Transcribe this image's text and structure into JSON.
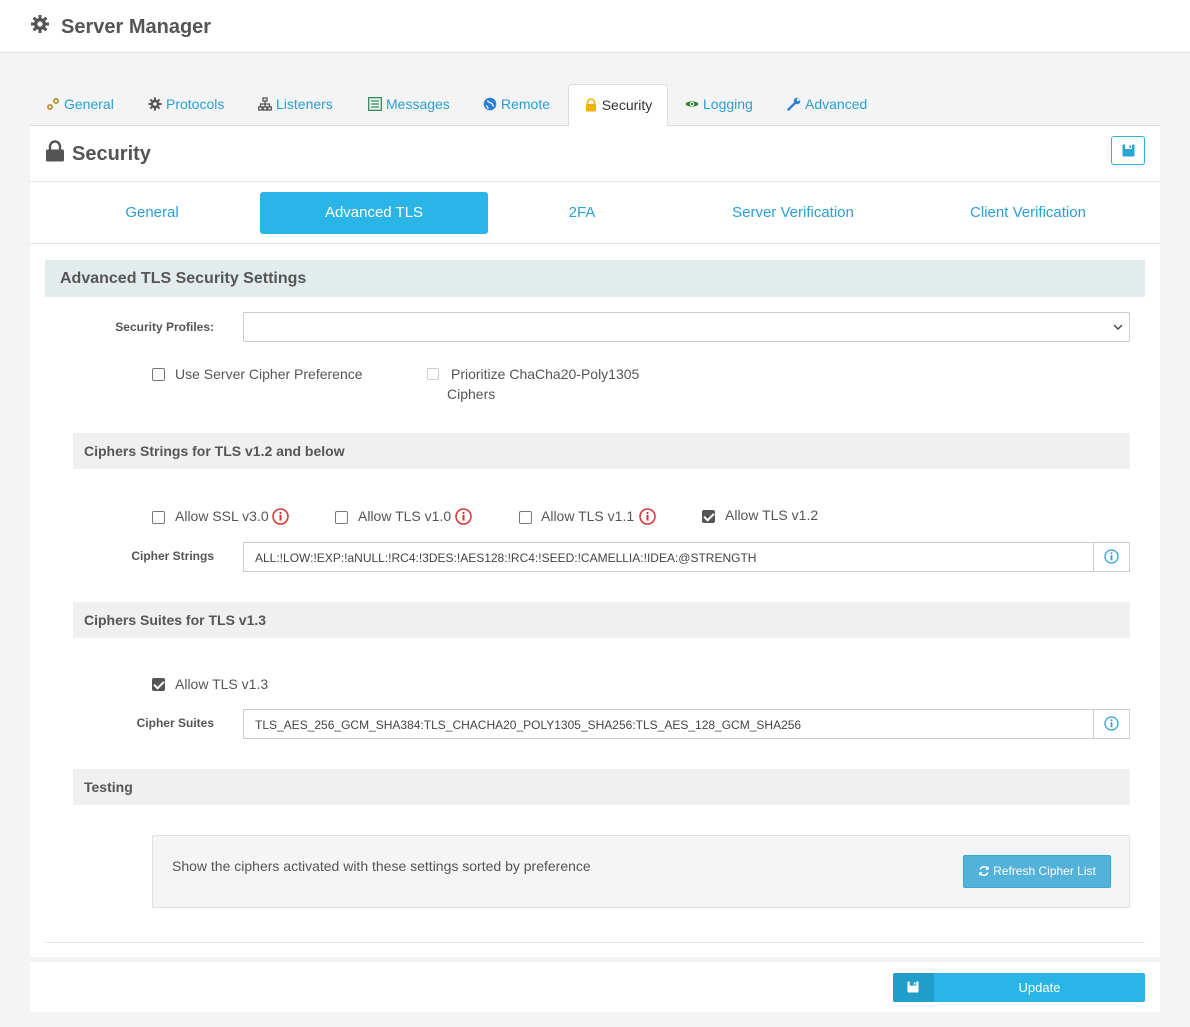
{
  "app": {
    "title": "Server Manager",
    "icon": "gear-icon"
  },
  "tabs": [
    {
      "label": "General",
      "icon": "cogs-icon"
    },
    {
      "label": "Protocols",
      "icon": "gear-icon"
    },
    {
      "label": "Listeners",
      "icon": "sitemap-icon"
    },
    {
      "label": "Messages",
      "icon": "list-icon"
    },
    {
      "label": "Remote",
      "icon": "globe-icon"
    },
    {
      "label": "Security",
      "icon": "lock-icon",
      "active": true
    },
    {
      "label": "Logging",
      "icon": "eye-icon"
    },
    {
      "label": "Advanced",
      "icon": "wrench-icon"
    }
  ],
  "panel": {
    "title": "Security",
    "icon": "lock-icon",
    "save_icon": "floppy-disk-icon"
  },
  "subtabs": [
    {
      "label": "General"
    },
    {
      "label": "Advanced TLS",
      "active": true
    },
    {
      "label": "2FA"
    },
    {
      "label": "Server Verification"
    },
    {
      "label": "Client Verification"
    }
  ],
  "section": {
    "title": "Advanced TLS Security Settings",
    "security_profiles": {
      "label": "Security Profiles:",
      "value": ""
    },
    "use_server_cipher_pref": {
      "label": "Use Server Cipher Preference",
      "checked": false
    },
    "prioritize_chacha": {
      "label_line1": "Prioritize ChaCha20-Poly1305",
      "label_line2": "Ciphers",
      "checked": false,
      "disabled": true
    }
  },
  "tls12": {
    "title": "Ciphers Strings for TLS v1.2 and below",
    "options": [
      {
        "label": "Allow SSL v3.0",
        "checked": false,
        "warning": true
      },
      {
        "label": "Allow TLS v1.0",
        "checked": false,
        "warning": true
      },
      {
        "label": "Allow TLS v1.1",
        "checked": false,
        "warning": true
      },
      {
        "label": "Allow TLS v1.2",
        "checked": true,
        "warning": false
      }
    ],
    "cipher_strings_label": "Cipher Strings",
    "cipher_strings_value": "ALL:!LOW:!EXP:!aNULL:!RC4:!3DES:!AES128:!RC4:!SEED:!CAMELLIA:!IDEA:@STRENGTH"
  },
  "tls13": {
    "title": "Ciphers Suites for TLS v1.3",
    "allow": {
      "label": "Allow TLS v1.3",
      "checked": true
    },
    "cipher_suites_label": "Cipher Suites",
    "cipher_suites_value": "TLS_AES_256_GCM_SHA384:TLS_CHACHA20_POLY1305_SHA256:TLS_AES_128_GCM_SHA256"
  },
  "testing": {
    "title": "Testing",
    "description": "Show the ciphers activated with these settings sorted by preference",
    "refresh_label": "Refresh Cipher List"
  },
  "footer": {
    "update_label": "Update"
  },
  "colors": {
    "accent": "#29b6e6",
    "link": "#2a9fd6",
    "warning": "#d9302c",
    "section_bg": "#e3ecec"
  }
}
